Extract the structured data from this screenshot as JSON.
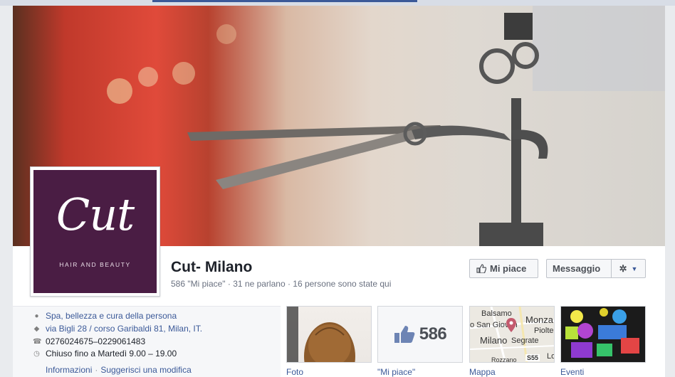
{
  "page": {
    "name": "Cut- Milano",
    "stats": "586 \"Mi piace\" · 31 ne parlano · 16 persone sono state qui"
  },
  "logo": {
    "script": "Cut",
    "subtitle": "HAIR AND BEAUTY"
  },
  "actions": {
    "like_label": "Mi piace",
    "message_label": "Messaggio"
  },
  "about": {
    "category": "Spa, bellezza e cura della persona",
    "address": "via Bigli 28 / corso Garibaldi 81, Milan, IT.",
    "phone": "0276024675–0229061483",
    "hours": "Chiuso fino a Martedì 9.00 – 19.00",
    "info_link": "Informazioni",
    "suggest_link": "Suggerisci una modifica"
  },
  "tiles": {
    "foto": "Foto",
    "likes": "\"Mi piace\"",
    "likes_count": "586",
    "map": "Mappa",
    "events": "Eventi"
  },
  "map_labels": {
    "balsamo": "Balsamo",
    "monza": "Monza",
    "san_giovanni": "o San Giovan",
    "pioltel": "Pioltel",
    "milano": "Milano",
    "segrate": "Segrate",
    "route": "S55",
    "bozzano": "Rozzano",
    "lo": "Lo"
  },
  "colors": {
    "facebook_blue": "#3b5998",
    "logo_purple": "#4a1d44"
  }
}
